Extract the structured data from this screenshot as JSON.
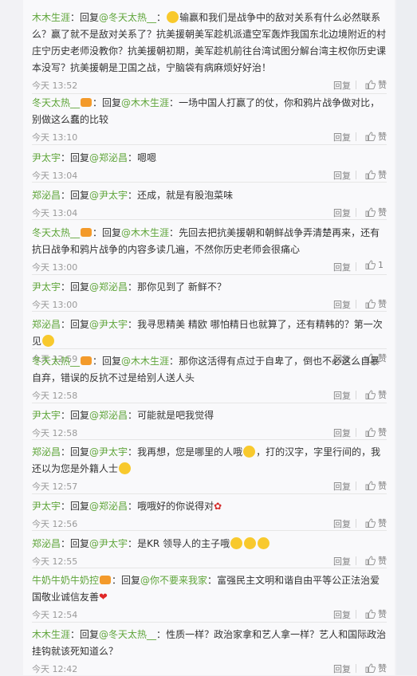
{
  "labels": {
    "reply": "回复",
    "like": "赞"
  },
  "comments": [
    {
      "author": "木木生涯",
      "rpre": "：回复",
      "mention": "@冬天太热__",
      "msep": "：",
      "body": "输赢和我们是战争中的敌对关系有什么必然联系么？赢了就不是敌对关系了？抗美援朝美军趁机派遣空军轰炸我国东北边境附近的村庄宁历史老师没教你？抗美援朝初期，美军趁机前往台湾试图分解台湾主权你历史课本没写？抗美援朝是卫国之战，宁脑袋有病麻烦好好治！",
      "time": "今天 13:52",
      "likes": "赞"
    },
    {
      "author": "冬天太热__",
      "rpre": "：回复",
      "mention": "@木木生涯",
      "msep": "：",
      "body": "一场中国人打赢了的仗，你和鸦片战争做对比，别做这么蠢的比较",
      "time": "今天 13:10",
      "likes": "赞"
    },
    {
      "author": "尹太宇",
      "rpre": "：回复",
      "mention": "@郑泌昌",
      "msep": "：",
      "body": "嗯嗯",
      "time": "今天 13:04",
      "likes": "赞"
    },
    {
      "author": "郑泌昌",
      "rpre": "：回复",
      "mention": "@尹太宇",
      "msep": "：",
      "body": "还成，就是有股泡菜味",
      "time": "今天 13:04",
      "likes": "赞"
    },
    {
      "author": "冬天太热__",
      "rpre": "：回复",
      "mention": "@木木生涯",
      "msep": "：",
      "body": "先回去把抗美援朝和朝鲜战争弄清楚再来，还有抗日战争和鸦片战争的内容多读几遍，不然你历史老师会很痛心",
      "time": "今天 13:00",
      "likes": "1"
    },
    {
      "author": "尹太宇",
      "rpre": "：回复",
      "mention": "@郑泌昌",
      "msep": "：",
      "body": "那你见到了 新鲜不？",
      "time": "今天 13:00",
      "likes": "赞"
    },
    {
      "author": "郑泌昌",
      "rpre": "：回复",
      "mention": "@尹太宇",
      "msep": "：",
      "body": "我寻思精美 精欧 哪怕精日也就算了，还有精韩的？第一次见",
      "time": "今天 12:59",
      "likes": "赞"
    },
    {
      "author": "冬天太热__",
      "rpre": "：回复",
      "mention": "@木木生涯",
      "msep": "：",
      "body": "那你这活得有点过于自卑了，倒也不必这么自暴自弃，错误的反抗不过是给别人送人头",
      "time": "今天 12:58",
      "likes": "赞"
    },
    {
      "author": "尹太宇",
      "rpre": "：回复",
      "mention": "@郑泌昌",
      "msep": "：",
      "body": "可能就是吧我觉得",
      "time": "今天 12:58",
      "likes": "赞"
    },
    {
      "author": "郑泌昌",
      "rpre": "：回复",
      "mention": "@尹太宇",
      "msep": "：",
      "body": "我再想，您是哪里的人哦",
      "body2": "，打的汉字，字里行间的，我还以为您是外籍人士",
      "time": "今天 12:57",
      "likes": "赞"
    },
    {
      "author": "尹太宇",
      "rpre": "：回复",
      "mention": "@郑泌昌",
      "msep": "：",
      "body": "哦哦好的你说得对",
      "time": "今天 12:56",
      "likes": "赞"
    },
    {
      "author": "郑泌昌",
      "rpre": "：回复",
      "mention": "@尹太宇",
      "msep": "：",
      "body": "是KR 领导人的主子哦",
      "time": "今天 12:55",
      "likes": "赞"
    },
    {
      "author": "牛奶牛奶牛奶控",
      "rpre": "：回复",
      "mention": "@你不要来我家",
      "msep": "：",
      "body": "富强民主文明和谐自由平等公正法治爱国敬业诚信友善",
      "time": "今天 12:54",
      "likes": "赞"
    },
    {
      "author": "木木生涯",
      "rpre": "：回复",
      "mention": "@冬天太热__",
      "msep": "：",
      "body": "性质一样？政治家拿和艺人拿一样？艺人和国际政治挂钩就该死知道么？",
      "time": "今天 12:42",
      "likes": "赞"
    }
  ]
}
